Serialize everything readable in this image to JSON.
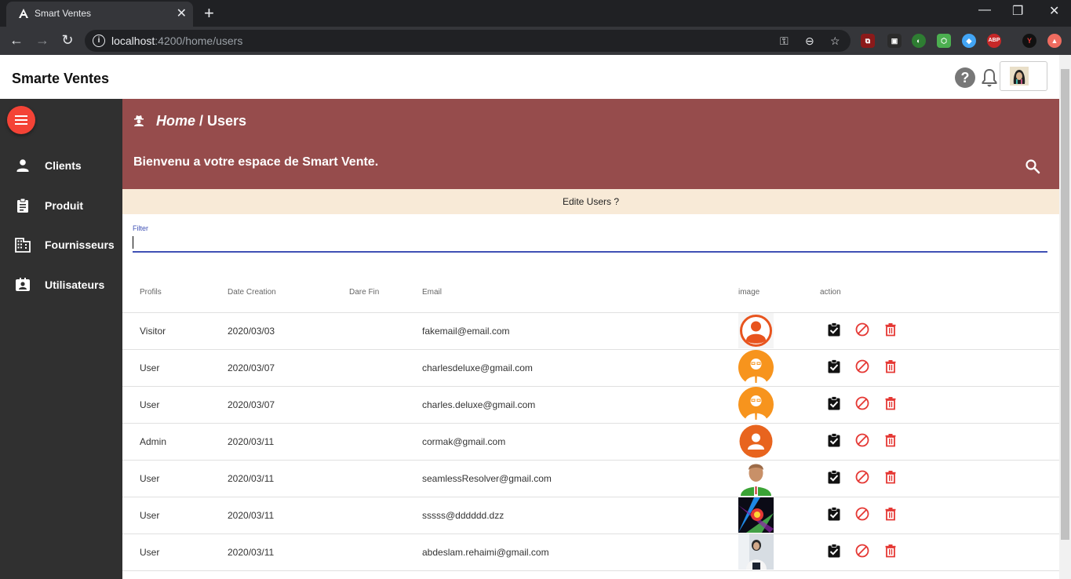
{
  "browser": {
    "tab_title": "Smart Ventes",
    "url_host": "localhost",
    "url_path": ":4200/home/users"
  },
  "app": {
    "brand": "Smarte Ventes",
    "help_glyph": "?"
  },
  "sidebar": {
    "items": [
      {
        "label": "Clients",
        "icon": "person-icon"
      },
      {
        "label": "Produit",
        "icon": "clipboard-icon"
      },
      {
        "label": "Fournisseurs",
        "icon": "building-icon"
      },
      {
        "label": "Utilisateurs",
        "icon": "contact-card-icon"
      }
    ]
  },
  "banner": {
    "home": "Home",
    "separator": " / ",
    "page": "Users",
    "welcome": "Bienvenu a votre espace de Smart Vente."
  },
  "edit_bar": "Edite Users ?",
  "filter": {
    "label": "Filter",
    "value": ""
  },
  "table": {
    "headers": [
      "Profils",
      "Date Creation",
      "Dare Fin",
      "Email",
      "image",
      "action"
    ],
    "rows": [
      {
        "profil": "Visitor",
        "date": "2020/03/03",
        "fin": "",
        "email": "fakemail@email.com",
        "image": "avatar-orange-circle"
      },
      {
        "profil": "User",
        "date": "2020/03/07",
        "fin": "",
        "email": "charlesdeluxe@gmail.com",
        "image": "avatar-businessman-orange"
      },
      {
        "profil": "User",
        "date": "2020/03/07",
        "fin": "",
        "email": "charles.deluxe@gmail.com",
        "image": "avatar-businessman-orange"
      },
      {
        "profil": "Admin",
        "date": "2020/03/11",
        "fin": "",
        "email": "cormak@gmail.com",
        "image": "avatar-person-orange"
      },
      {
        "profil": "User",
        "date": "2020/03/11",
        "fin": "",
        "email": "seamlessResolver@gmail.com",
        "image": "avatar-green-man"
      },
      {
        "profil": "User",
        "date": "2020/03/11",
        "fin": "",
        "email": "sssss@dddddd.dzz",
        "image": "photo-colorful"
      },
      {
        "profil": "User",
        "date": "2020/03/11",
        "fin": "",
        "email": "abdeslam.rehaimi@gmail.com",
        "image": "photo-person"
      }
    ]
  },
  "colors": {
    "banner": "#964c4c",
    "sidebar": "#303030",
    "fab": "#f44336",
    "edit_bar": "#f8ead7",
    "accent": "#3f51b5",
    "danger": "#f44336"
  }
}
